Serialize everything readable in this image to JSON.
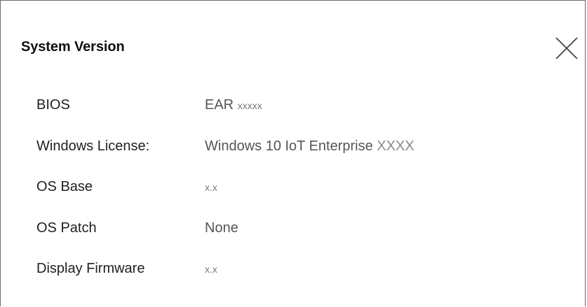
{
  "dialog": {
    "title": "System Version",
    "close_icon": "close-icon"
  },
  "rows": [
    {
      "label": "BIOS",
      "value_main": "EAR",
      "value_suffix": "xxxxx"
    },
    {
      "label": "Windows License:",
      "value_main": "Windows 10 IoT Enterprise",
      "value_suffix": "XXXX"
    },
    {
      "label": "OS Base",
      "value_main": "",
      "value_suffix": "x.x"
    },
    {
      "label": "OS Patch",
      "value_main": "None",
      "value_suffix": ""
    },
    {
      "label": "Display Firmware",
      "value_main": "",
      "value_suffix": "x.x"
    }
  ]
}
